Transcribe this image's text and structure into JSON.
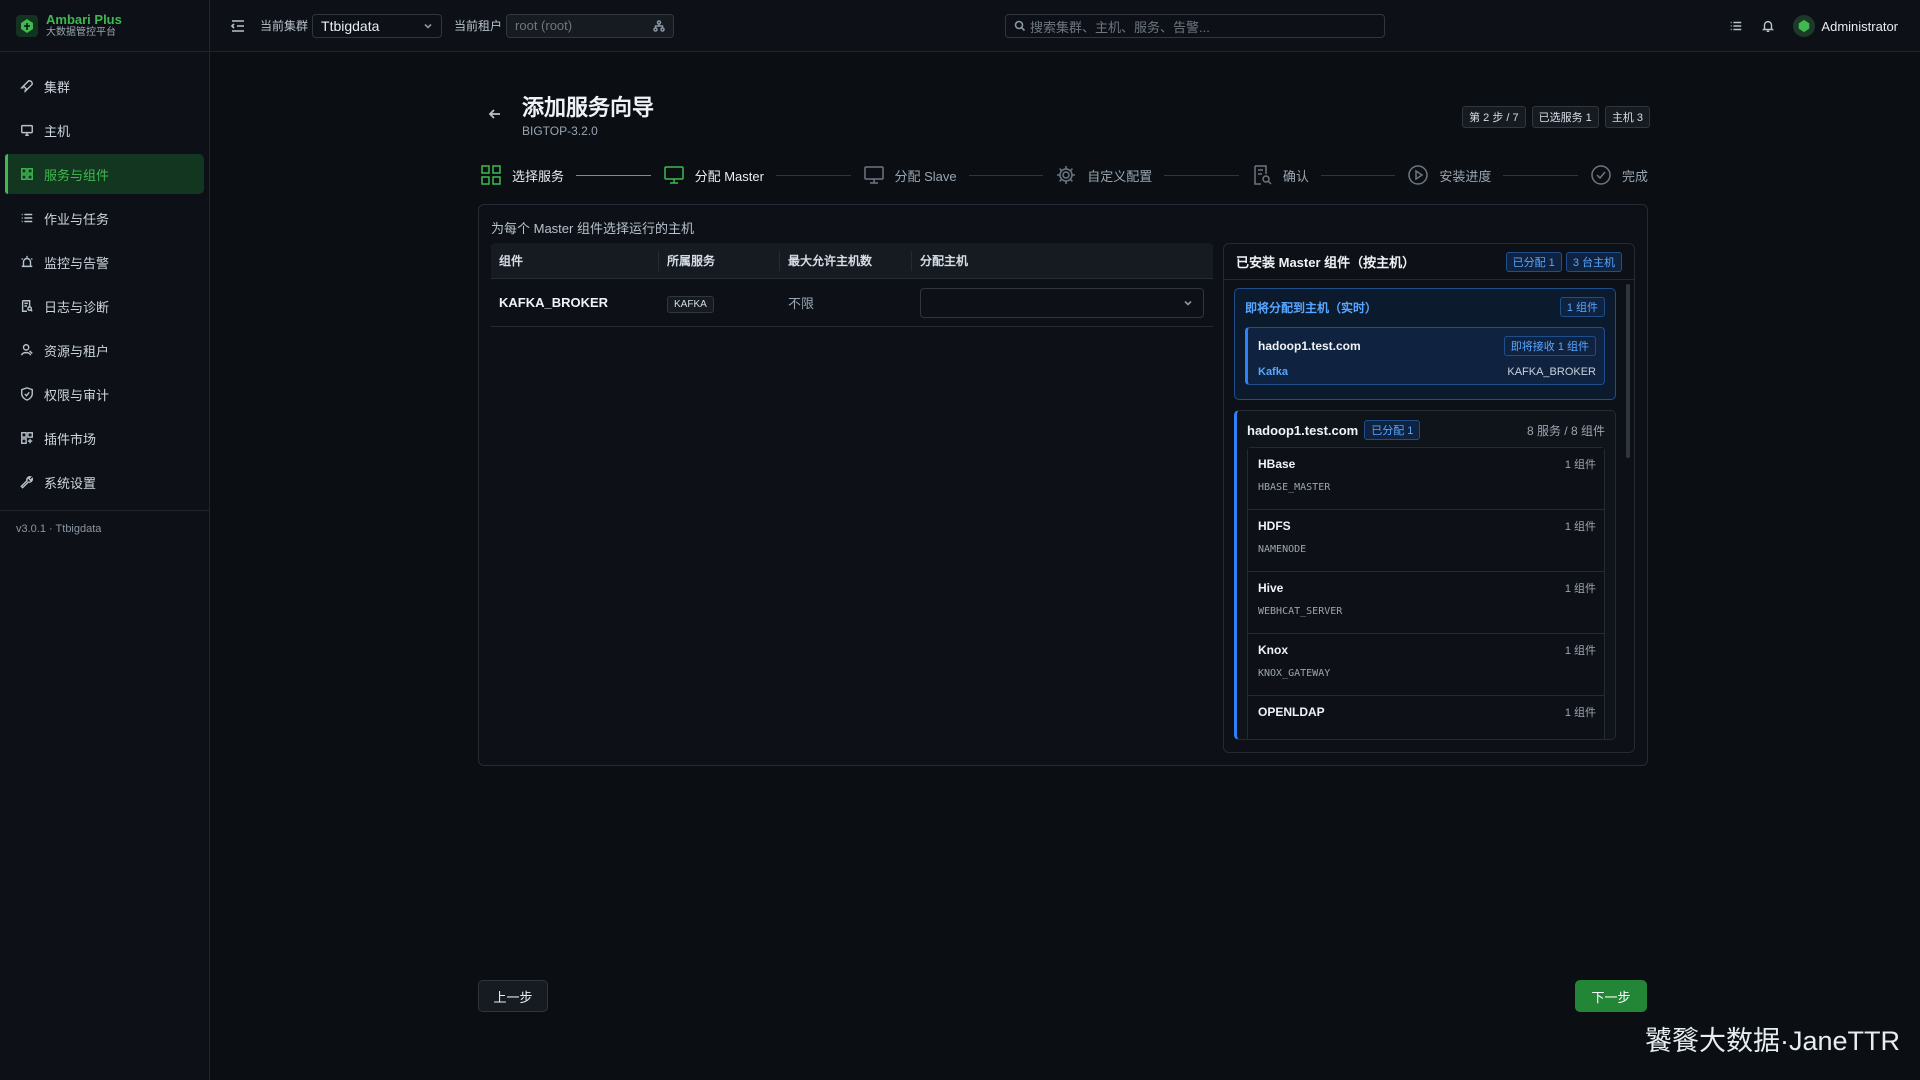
{
  "brand": {
    "name": "Ambari Plus",
    "subtitle": "大数据管控平台",
    "accent": "#3fb950"
  },
  "sidebar": {
    "items": [
      {
        "label": "集群",
        "icon": "rocket-icon",
        "active": false
      },
      {
        "label": "主机",
        "icon": "monitor-icon",
        "active": false
      },
      {
        "label": "服务与组件",
        "icon": "grid-icon",
        "active": true
      },
      {
        "label": "作业与任务",
        "icon": "list-icon",
        "active": false
      },
      {
        "label": "监控与告警",
        "icon": "alarm-icon",
        "active": false
      },
      {
        "label": "日志与诊断",
        "icon": "log-search-icon",
        "active": false
      },
      {
        "label": "资源与租户",
        "icon": "user-icon",
        "active": false
      },
      {
        "label": "权限与审计",
        "icon": "shield-icon",
        "active": false
      },
      {
        "label": "插件市场",
        "icon": "plugin-icon",
        "active": false
      },
      {
        "label": "系统设置",
        "icon": "wrench-icon",
        "active": false
      }
    ],
    "version": "v3.0.1 · Ttbigdata"
  },
  "topbar": {
    "cluster_label": "当前集群",
    "cluster_value": "Ttbigdata",
    "tenant_label": "当前租户",
    "tenant_placeholder": "root (root)",
    "search_placeholder": "搜索集群、主机、服务、告警...",
    "username": "Administrator"
  },
  "page": {
    "title": "添加服务向导",
    "subtitle": "BIGTOP-3.2.0",
    "badges": [
      "第 2 步 / 7",
      "已选服务 1",
      "主机 3"
    ]
  },
  "steps": [
    {
      "label": "选择服务",
      "icon": "grid-icon",
      "state": "done"
    },
    {
      "label": "分配 Master",
      "icon": "monitor-icon",
      "state": "current"
    },
    {
      "label": "分配 Slave",
      "icon": "monitor-icon",
      "state": "todo"
    },
    {
      "label": "自定义配置",
      "icon": "gear-icon",
      "state": "todo"
    },
    {
      "label": "确认",
      "icon": "document-search-icon",
      "state": "todo"
    },
    {
      "label": "安装进度",
      "icon": "play-circle-icon",
      "state": "todo"
    },
    {
      "label": "完成",
      "icon": "check-circle-icon",
      "state": "todo"
    }
  ],
  "assign": {
    "hint": "为每个 Master 组件选择运行的主机",
    "columns": [
      "组件",
      "所属服务",
      "最大允许主机数",
      "分配主机"
    ],
    "rows": [
      {
        "component": "KAFKA_BROKER",
        "service": "KAFKA",
        "max_hosts": "不限",
        "host": ""
      }
    ]
  },
  "installed": {
    "title": "已安装 Master 组件（按主机）",
    "pills": [
      "已分配 1",
      "3 台主机"
    ],
    "pending": {
      "title": "即将分配到主机（实时）",
      "count": "1 组件",
      "host": "hadoop1.test.com",
      "receive": "即将接收 1 组件",
      "service": "Kafka",
      "component": "KAFKA_BROKER"
    },
    "host_group": {
      "host": "hadoop1.test.com",
      "tag": "已分配 1",
      "stats": "8 服务 / 8 组件",
      "services": [
        {
          "name": "HBase",
          "count": "1 组件",
          "component": "HBASE_MASTER"
        },
        {
          "name": "HDFS",
          "count": "1 组件",
          "component": "NAMENODE"
        },
        {
          "name": "Hive",
          "count": "1 组件",
          "component": "WEBHCAT_SERVER"
        },
        {
          "name": "Knox",
          "count": "1 组件",
          "component": "KNOX_GATEWAY"
        },
        {
          "name": "OPENLDAP",
          "count": "1 组件",
          "component": ""
        }
      ]
    }
  },
  "buttons": {
    "prev": "上一步",
    "next": "下一步"
  },
  "watermark": "饕餮大数据·JaneTTR"
}
